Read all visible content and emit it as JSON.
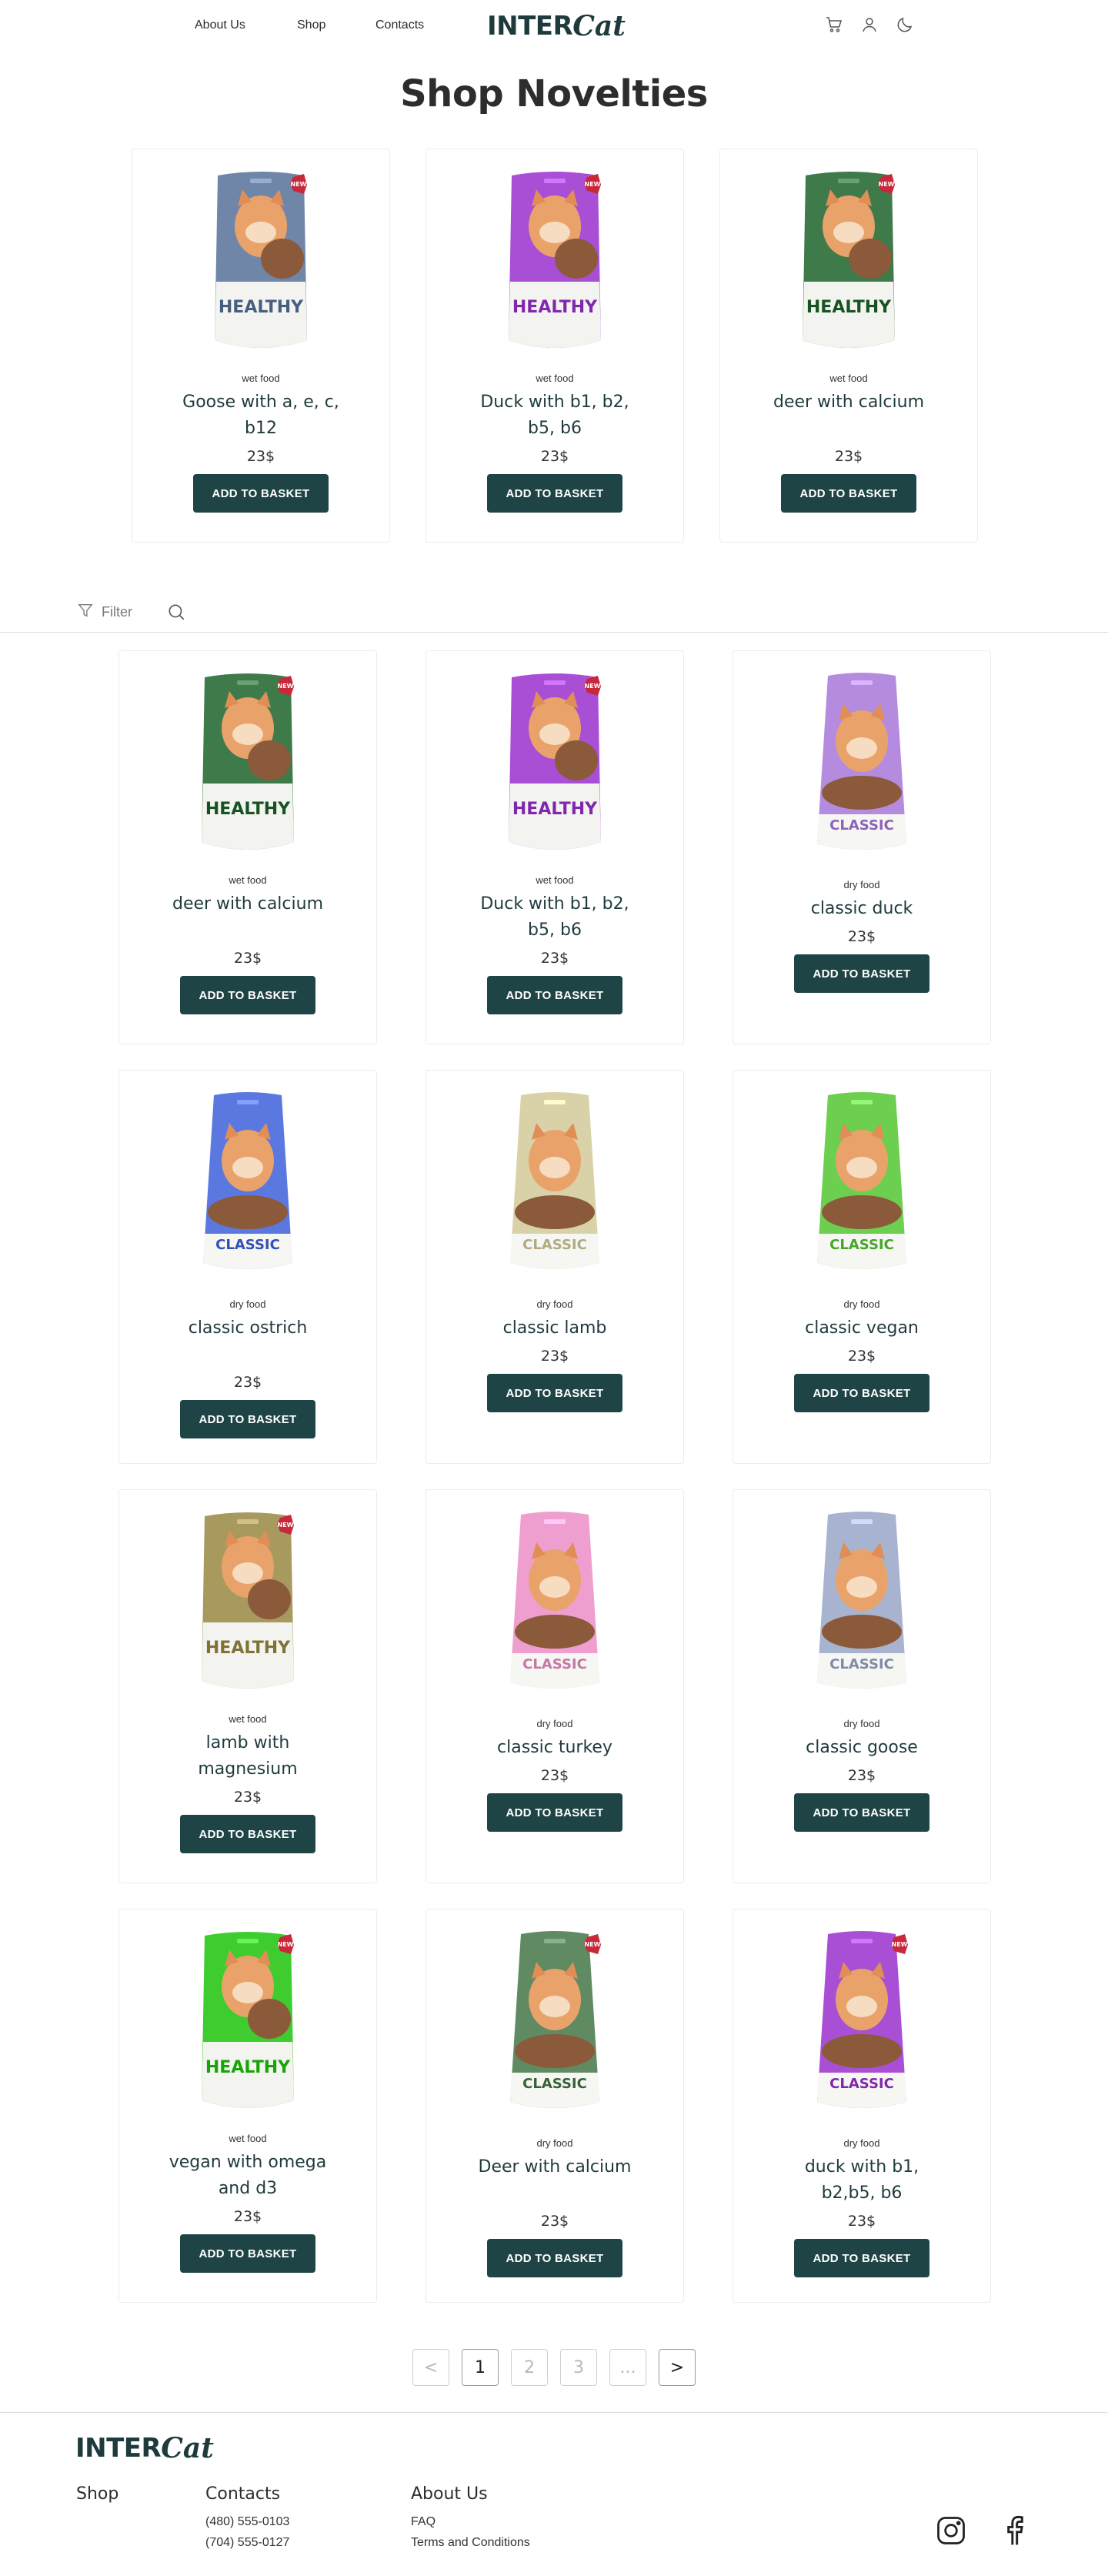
{
  "header": {
    "nav": [
      "About Us",
      "Shop",
      "Contacts"
    ],
    "logo_main": "INTER",
    "logo_script": "Cat",
    "icons": [
      "cart-icon",
      "user-icon",
      "moon-icon"
    ]
  },
  "title": "Shop Novelties",
  "novelties": [
    {
      "category": "wet food",
      "name": "Goose with a, e, c, b12",
      "price": "23$",
      "button": "ADD TO BASKET",
      "bag_color": "#6f86a8",
      "bag_type": "HEALTHY",
      "badge": true
    },
    {
      "category": "wet food",
      "name": "Duck with b1, b2, b5, b6",
      "price": "23$",
      "button": "ADD TO BASKET",
      "bag_color": "#a94fd6",
      "bag_type": "HEALTHY",
      "badge": true
    },
    {
      "category": "wet food",
      "name": "deer with calcium",
      "price": "23$",
      "button": "ADD TO BASKET",
      "bag_color": "#3f7a4a",
      "bag_type": "HEALTHY",
      "badge": true
    }
  ],
  "filter": {
    "label": "Filter"
  },
  "products": [
    {
      "category": "wet food",
      "name": "deer with calcium",
      "price": "23$",
      "button": "ADD TO BASKET",
      "bag_color": "#3f7a4a",
      "bag_type": "HEALTHY",
      "badge": true
    },
    {
      "category": "wet food",
      "name": "Duck with b1, b2, b5, b6",
      "price": "23$",
      "button": "ADD TO BASKET",
      "bag_color": "#a94fd6",
      "bag_type": "HEALTHY",
      "badge": true
    },
    {
      "category": "dry food",
      "name": "classic duck",
      "price": "23$",
      "button": "ADD TO BASKET",
      "bag_color": "#b58be0",
      "bag_type": "CLASSIC",
      "badge": false
    },
    {
      "category": "dry food",
      "name": "classic ostrich",
      "price": "23$",
      "button": "ADD TO BASKET",
      "bag_color": "#5b78e0",
      "bag_type": "CLASSIC",
      "badge": false
    },
    {
      "category": "dry food",
      "name": "classic lamb",
      "price": "23$",
      "button": "ADD TO BASKET",
      "bag_color": "#d9d2a8",
      "bag_type": "CLASSIC",
      "badge": false
    },
    {
      "category": "dry food",
      "name": "classic vegan",
      "price": "23$",
      "button": "ADD TO BASKET",
      "bag_color": "#6ccf4f",
      "bag_type": "CLASSIC",
      "badge": false
    },
    {
      "category": "wet food",
      "name": "lamb with magnesium",
      "price": "23$",
      "button": "ADD TO BASKET",
      "bag_color": "#a89a5e",
      "bag_type": "HEALTHY",
      "badge": true
    },
    {
      "category": "dry food",
      "name": "classic turkey",
      "price": "23$",
      "button": "ADD TO BASKET",
      "bag_color": "#ef9fcf",
      "bag_type": "CLASSIC",
      "badge": false
    },
    {
      "category": "dry food",
      "name": "classic goose",
      "price": "23$",
      "button": "ADD TO BASKET",
      "bag_color": "#a8b4cf",
      "bag_type": "CLASSIC",
      "badge": false
    },
    {
      "category": "wet food",
      "name": "vegan with omega and d3",
      "price": "23$",
      "button": "ADD TO BASKET",
      "bag_color": "#3fcc2f",
      "bag_type": "HEALTHY",
      "badge": true
    },
    {
      "category": "dry food",
      "name": "Deer with calcium",
      "price": "23$",
      "button": "ADD TO BASKET",
      "bag_color": "#5f8a62",
      "bag_type": "CLASSIC",
      "badge": true
    },
    {
      "category": "dry food",
      "name": "duck with b1, b2,b5, b6",
      "price": "23$",
      "button": "ADD TO BASKET",
      "bag_color": "#a94fd6",
      "bag_type": "CLASSIC",
      "badge": true
    }
  ],
  "pagination": {
    "prev": "<",
    "pages": [
      "1",
      "2",
      "3",
      "..."
    ],
    "next": ">",
    "active": "1"
  },
  "footer": {
    "logo_main": "INTER",
    "logo_script": "Cat",
    "shop_title": "Shop",
    "contacts_title": "Contacts",
    "phones": [
      "(480) 555-0103",
      "(704) 555-0127"
    ],
    "about_title": "About Us",
    "about_links": [
      "FAQ",
      "Terms and Conditions"
    ],
    "social": [
      "instagram-icon",
      "facebook-icon"
    ]
  }
}
